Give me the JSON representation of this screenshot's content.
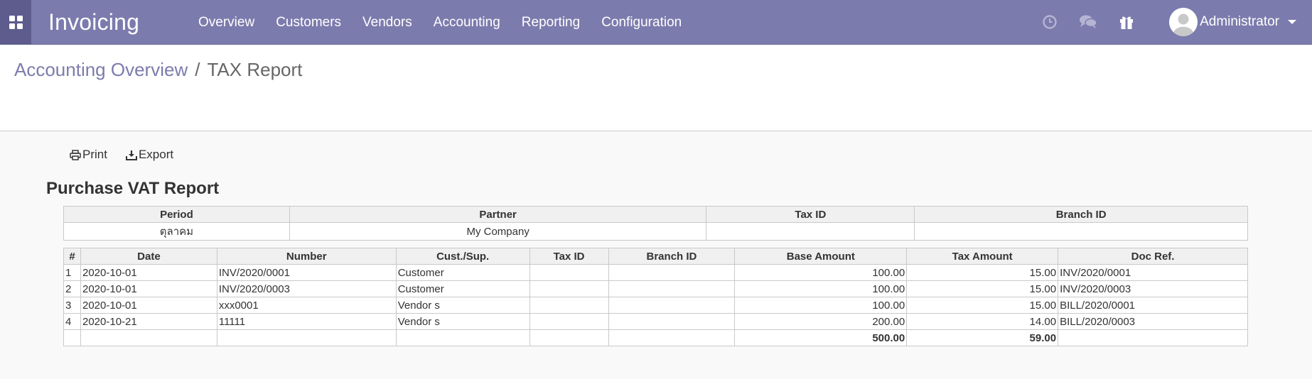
{
  "navbar": {
    "app_title": "Invoicing",
    "menu": [
      "Overview",
      "Customers",
      "Vendors",
      "Accounting",
      "Reporting",
      "Configuration"
    ],
    "user_name": "Administrator",
    "icons": [
      "apps-grid-icon",
      "clock-icon",
      "chat-icon",
      "gift-icon"
    ],
    "colors": {
      "bar": "#7c7bad",
      "apps_button": "#5d5c8d"
    }
  },
  "breadcrumb": {
    "parent": "Accounting Overview",
    "separator": "/",
    "current": "TAX Report"
  },
  "toolbar": {
    "print_label": "Print",
    "export_label": "Export"
  },
  "report": {
    "title": "Purchase VAT Report",
    "header_columns": [
      "Period",
      "Partner",
      "Tax ID",
      "Branch ID"
    ],
    "header_values": [
      "ตุลาคม",
      "My Company",
      "",
      ""
    ],
    "columns": [
      "#",
      "Date",
      "Number",
      "Cust./Sup.",
      "Tax ID",
      "Branch ID",
      "Base Amount",
      "Tax Amount",
      "Doc Ref."
    ],
    "rows": [
      [
        "1",
        "2020-10-01",
        "INV/2020/0001",
        "Customer",
        "",
        "",
        "100.00",
        "15.00",
        "INV/2020/0001"
      ],
      [
        "2",
        "2020-10-01",
        "INV/2020/0003",
        "Customer",
        "",
        "",
        "100.00",
        "15.00",
        "INV/2020/0003"
      ],
      [
        "3",
        "2020-10-01",
        "xxx0001",
        "Vendor s",
        "",
        "",
        "100.00",
        "15.00",
        "BILL/2020/0001"
      ],
      [
        "4",
        "2020-10-21",
        "11111",
        "Vendor s",
        "",
        "",
        "200.00",
        "14.00",
        "BILL/2020/0003"
      ]
    ],
    "totals": {
      "base_amount": "500.00",
      "tax_amount": "59.00"
    }
  }
}
